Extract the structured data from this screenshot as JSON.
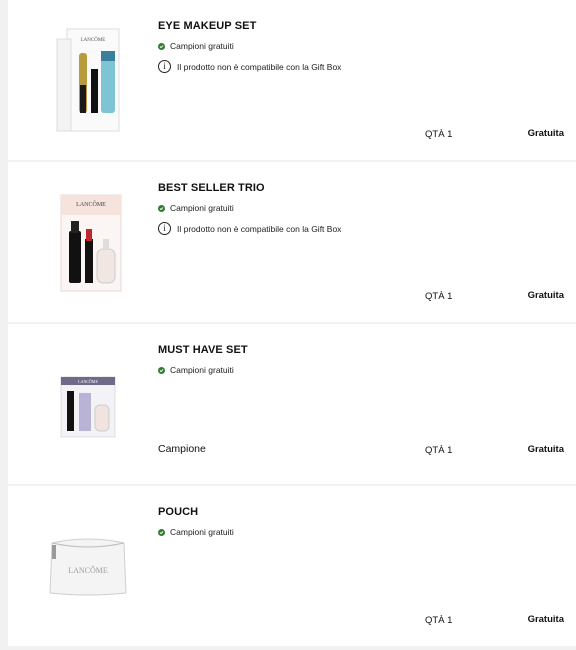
{
  "items": [
    {
      "name": "EYE MAKEUP SET",
      "free_label": "Campioni gratuiti",
      "note": "Il prodotto non è compatibile con la Gift Box",
      "sample_tag": "",
      "qty": "QTÀ 1",
      "price": "Gratuita",
      "image_brand": "LANCÔME"
    },
    {
      "name": "BEST SELLER TRIO",
      "free_label": "Campioni gratuiti",
      "note": "Il prodotto non è compatibile con la Gift Box",
      "sample_tag": "",
      "qty": "QTÀ 1",
      "price": "Gratuita",
      "image_brand": "LANCÔME"
    },
    {
      "name": "MUST HAVE SET",
      "free_label": "Campioni gratuiti",
      "note": "",
      "sample_tag": "Campione",
      "qty": "QTÀ 1",
      "price": "Gratuita",
      "image_brand": "LANCÔME"
    },
    {
      "name": "POUCH",
      "free_label": "Campioni gratuiti",
      "note": "",
      "sample_tag": "",
      "qty": "QTÀ 1",
      "price": "Gratuita",
      "image_brand": "LANCÔME"
    }
  ],
  "icons": {
    "check": "check-circle-icon",
    "info": "info-icon"
  },
  "colors": {
    "check_green": "#2e7d32",
    "background": "#f1f1f1",
    "card": "#ffffff"
  }
}
